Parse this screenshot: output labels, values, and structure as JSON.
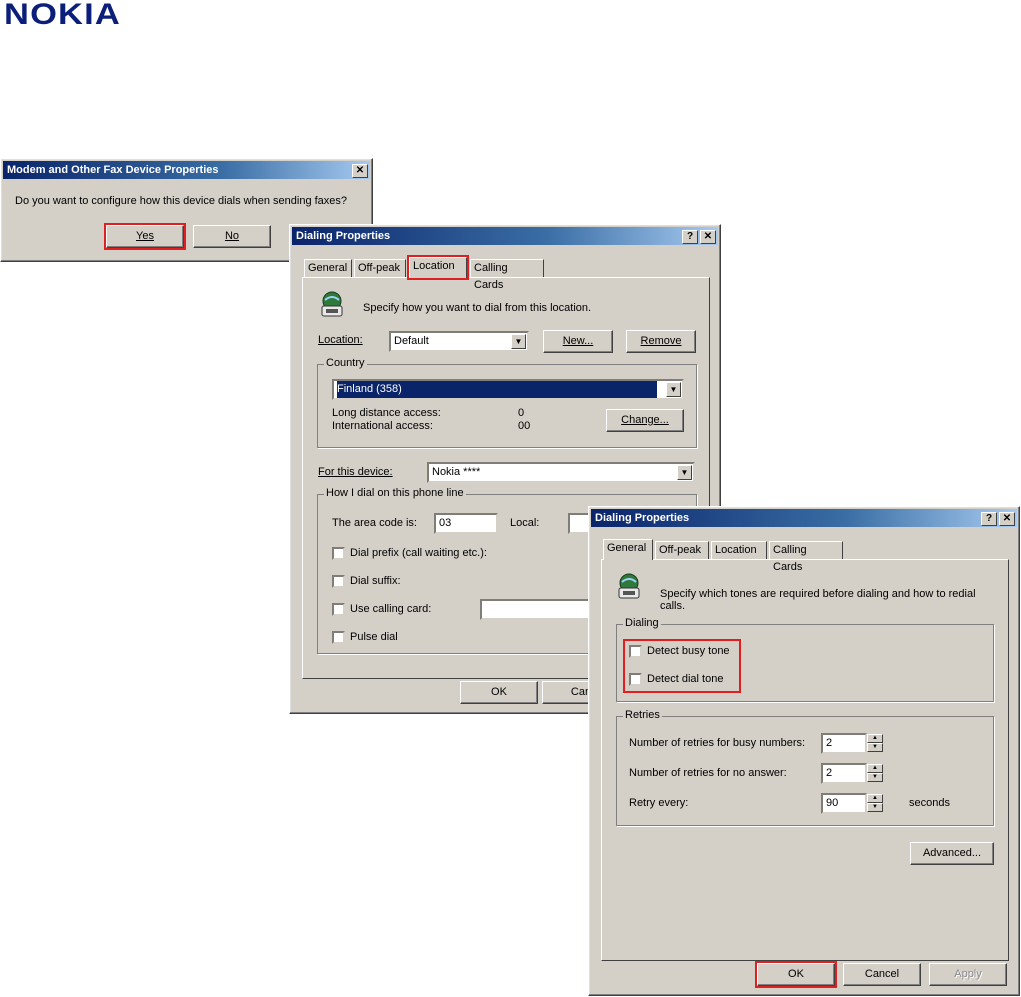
{
  "logo": {
    "text": "NOKIA",
    "color": "#0b1e7a"
  },
  "highlight_color": "#e02020",
  "dialog1": {
    "title": "Modem and Other Fax Device Properties",
    "question": "Do you want to configure how this device dials when sending faxes?",
    "yes_label": "Yes",
    "no_label": "No",
    "close_glyph": "✕"
  },
  "dialog2": {
    "title": "Dialing Properties",
    "help_glyph": "?",
    "close_glyph": "✕",
    "tabs": [
      {
        "label": "General"
      },
      {
        "label": "Off-peak"
      },
      {
        "label": "Location"
      },
      {
        "label": "Calling Cards"
      }
    ],
    "intro": "Specify how you want to dial from this location.",
    "location_label": "Location:",
    "location_value": "Default",
    "new_button": "New...",
    "remove_button": "Remove",
    "country_group": "Country",
    "country_value": "Finland (358)",
    "long_distance_label": "Long distance access:",
    "long_distance_value": "0",
    "international_label": "International access:",
    "international_value": "00",
    "change_button": "Change...",
    "device_label": "For this device:",
    "device_value": "Nokia ****",
    "howdial_group": "How I dial on this phone line",
    "area_code_label": "The area code is:",
    "area_code_value": "03",
    "local_label": "Local:",
    "dial_prefix_label": "Dial prefix (call waiting etc.):",
    "dial_suffix_label": "Dial suffix:",
    "calling_card_label": "Use calling card:",
    "pulse_dial_label": "Pulse dial",
    "ok_button": "OK",
    "cancel_button": "Can"
  },
  "dialog3": {
    "title": "Dialing Properties",
    "help_glyph": "?",
    "close_glyph": "✕",
    "tabs": [
      {
        "label": "General"
      },
      {
        "label": "Off-peak"
      },
      {
        "label": "Location"
      },
      {
        "label": "Calling Cards"
      }
    ],
    "intro": "Specify which tones are required before dialing and how to redial calls.",
    "dialing_group": "Dialing",
    "detect_busy_label": "Detect busy tone",
    "detect_dial_label": "Detect dial tone",
    "retries_group": "Retries",
    "retries_busy_label": "Number of retries for busy numbers:",
    "retries_busy_value": "2",
    "retries_noanswer_label": "Number of retries for no answer:",
    "retries_noanswer_value": "2",
    "retry_every_label": "Retry every:",
    "retry_every_value": "90",
    "seconds_label": "seconds",
    "advanced_button": "Advanced...",
    "ok_button": "OK",
    "cancel_button": "Cancel",
    "apply_button": "Apply"
  }
}
